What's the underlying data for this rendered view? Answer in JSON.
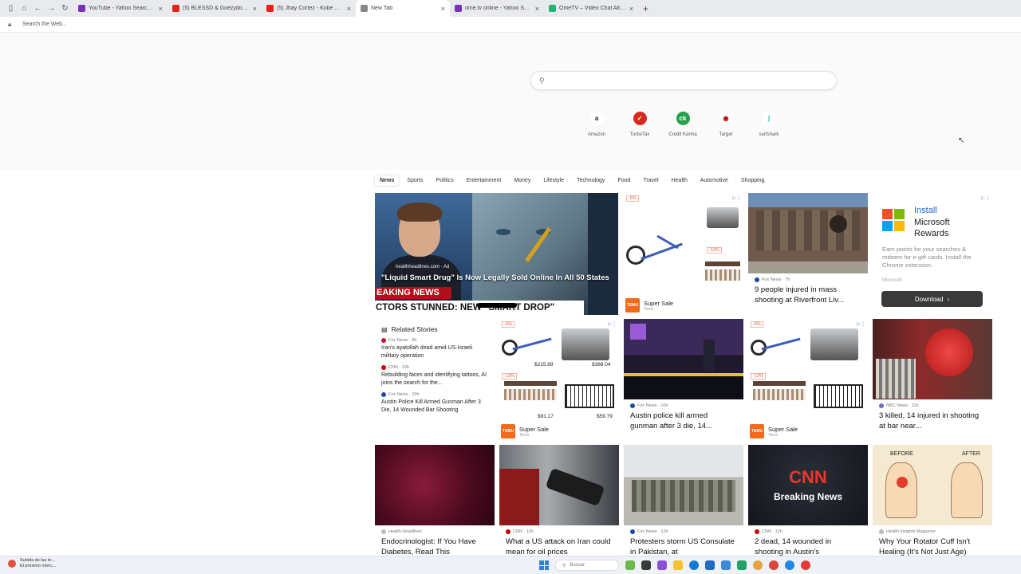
{
  "browser": {
    "tabs": [
      {
        "title": "YouTube - Yahoo Search Re",
        "color": "#7b2fbf",
        "active": false
      },
      {
        "title": "(5) BLESSD & Goezydoe - D",
        "color": "#e62117",
        "active": false
      },
      {
        "title": "(5) Jhay Cortez - Kobe En L",
        "color": "#e62117",
        "active": false
      },
      {
        "title": "New Tab",
        "color": "#888888",
        "active": true
      },
      {
        "title": "ome.tv online - Yahoo Sear",
        "color": "#7b2fbf",
        "active": false
      },
      {
        "title": "OmeTV – Video Chat Altern",
        "color": "#21b573",
        "active": false
      }
    ],
    "new_tab_symbol": "+",
    "address": "Search the Web..."
  },
  "search": {
    "placeholder": ""
  },
  "shortcuts": [
    {
      "label": "Amazon",
      "glyph": "a",
      "bg": "#ffffff",
      "fg": "#222222"
    },
    {
      "label": "TurboTax",
      "glyph": "✓",
      "bg": "#d52b1e",
      "fg": "#ffffff"
    },
    {
      "label": "Credit Karma",
      "glyph": "ck",
      "bg": "#24a148",
      "fg": "#ffffff"
    },
    {
      "label": "Target",
      "glyph": "◉",
      "bg": "#ffffff",
      "fg": "#cc0000"
    },
    {
      "label": "surfshark",
      "glyph": "ʃ",
      "bg": "#ffffff",
      "fg": "#1ec0a8"
    }
  ],
  "categories": [
    "News",
    "Sports",
    "Politics",
    "Entertainment",
    "Money",
    "Lifestyle",
    "Technology",
    "Food",
    "Travel",
    "Health",
    "Automotive",
    "Shopping"
  ],
  "hero": {
    "source": "healthheadlines.com · Ad",
    "headline": "\"Liquid Smart Drug\" Is Now Legally Sold Online In All 50 States",
    "breaking": "EAKING NEWS",
    "ticker": "CTORS STUNNED: NEW \"SMART DROP\""
  },
  "sale1": {
    "badge": "-5%",
    "badge2": "-13%",
    "name": "Super Sale",
    "sub": "Temu",
    "temu": "TEMU"
  },
  "card_shooting": {
    "source": "Fox News · 7h",
    "title": "9 people injured in mass shooting at Riverfront Liv..."
  },
  "ms_ad": {
    "title1": "Install",
    "title2": "Microsoft Rewards",
    "desc": "Earn points for your searches & redeem for e-gift cards. Install the Chrome extension.",
    "brand": "Microsoft",
    "button": "Download"
  },
  "related": {
    "header": "Related Stories",
    "items": [
      {
        "source": "Fox News · 8h",
        "title": "Iran's ayatollah dead amid US-Israeli military operation",
        "color": "#c8102e"
      },
      {
        "source": "CNN · 10h",
        "title": "Rebuilding faces and identifying tattoos, AI joins the search for the...",
        "color": "#cc0000"
      },
      {
        "source": "Fox News · 10h",
        "title": "Austin Police Kill Armed Gunman After 3 Die, 14 Wounded Bar Shooting",
        "color": "#1a4b9c"
      }
    ]
  },
  "sale2": {
    "badge": "-5%",
    "badge2": "-13%",
    "price1": "$215.89",
    "price2": "$388.04",
    "price3": "$91.17",
    "price4": "$59.79",
    "name": "Super Sale",
    "sub": "Temu",
    "temu": "TEMU"
  },
  "card_austin": {
    "source": "Fox News · 10h",
    "title": "Austin police kill armed gunman after 3 die, 14..."
  },
  "sale3": {
    "badge": "-5%",
    "badge2": "-13%",
    "name": "Super Sale",
    "sub": "Temu",
    "temu": "TEMU"
  },
  "card_nbc": {
    "source": "NBC News · 11h",
    "title": "3 killed, 14 injured in shooting at bar near..."
  },
  "row3": [
    {
      "source": "Health Headlines",
      "title": "Endocrinologist: If You Have Diabetes, Read This"
    },
    {
      "source": "CNN · 11h",
      "title": "What a US attack on Iran could mean for oil prices"
    },
    {
      "source": "Fox News · 12h",
      "title": "Protesters storm US Consulate in Pakistan, at"
    },
    {
      "source": "CNN · 12h",
      "title": "2 dead, 14 wounded in shooting in Austin's"
    },
    {
      "source": "Health Insights Magazine",
      "title": "Why Your Rotator Cuff Isn't Healing (It's Not Just Age)"
    }
  ],
  "cnn_image": {
    "logo": "CNN",
    "text": "Breaking News"
  },
  "rotator_image": {
    "before": "BEFORE",
    "after": "AFTER"
  },
  "taskbar": {
    "weather_line1": "Subida de las te...",
    "weather_line2": "El próximo miérc...",
    "search": "Buscar"
  }
}
